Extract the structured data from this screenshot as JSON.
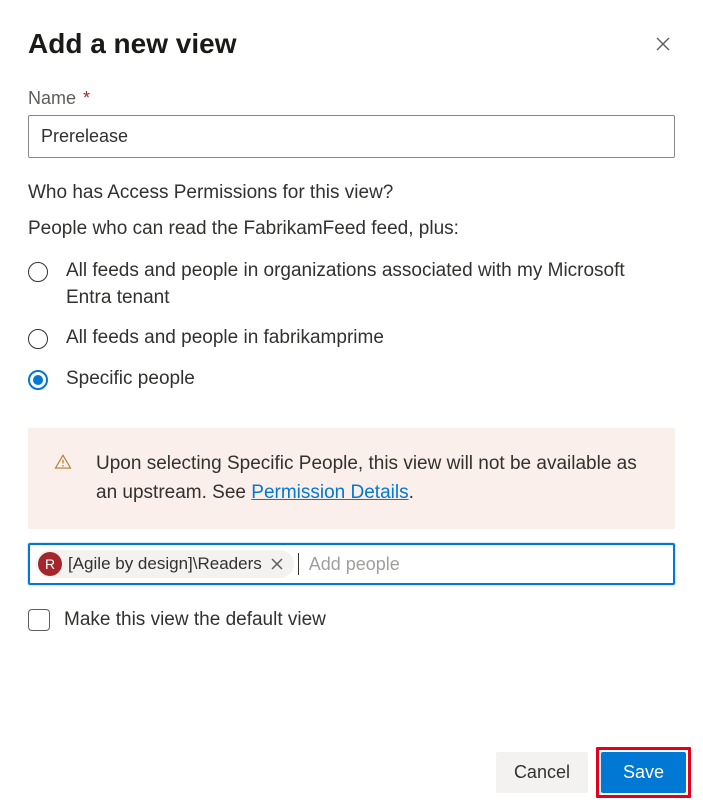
{
  "title": "Add a new view",
  "name_field": {
    "label": "Name",
    "required_mark": "*",
    "value": "Prerelease"
  },
  "permissions": {
    "heading": "Who has Access Permissions for this view?",
    "subheading": "People who can read the FabrikamFeed feed, plus:",
    "options": [
      {
        "label": "All feeds and people in organizations associated with my Microsoft Entra tenant",
        "selected": false
      },
      {
        "label": "All feeds and people in fabrikamprime",
        "selected": false
      },
      {
        "label": "Specific people",
        "selected": true
      }
    ]
  },
  "warning": {
    "text_before": "Upon selecting Specific People, this view will not be available as an upstream. See ",
    "link_text": "Permission Details",
    "text_after": "."
  },
  "people_picker": {
    "chip": {
      "initial": "R",
      "label": "[Agile by design]\\Readers"
    },
    "placeholder": "Add people"
  },
  "default_view": {
    "label": "Make this view the default view",
    "checked": false
  },
  "footer": {
    "cancel": "Cancel",
    "save": "Save"
  }
}
